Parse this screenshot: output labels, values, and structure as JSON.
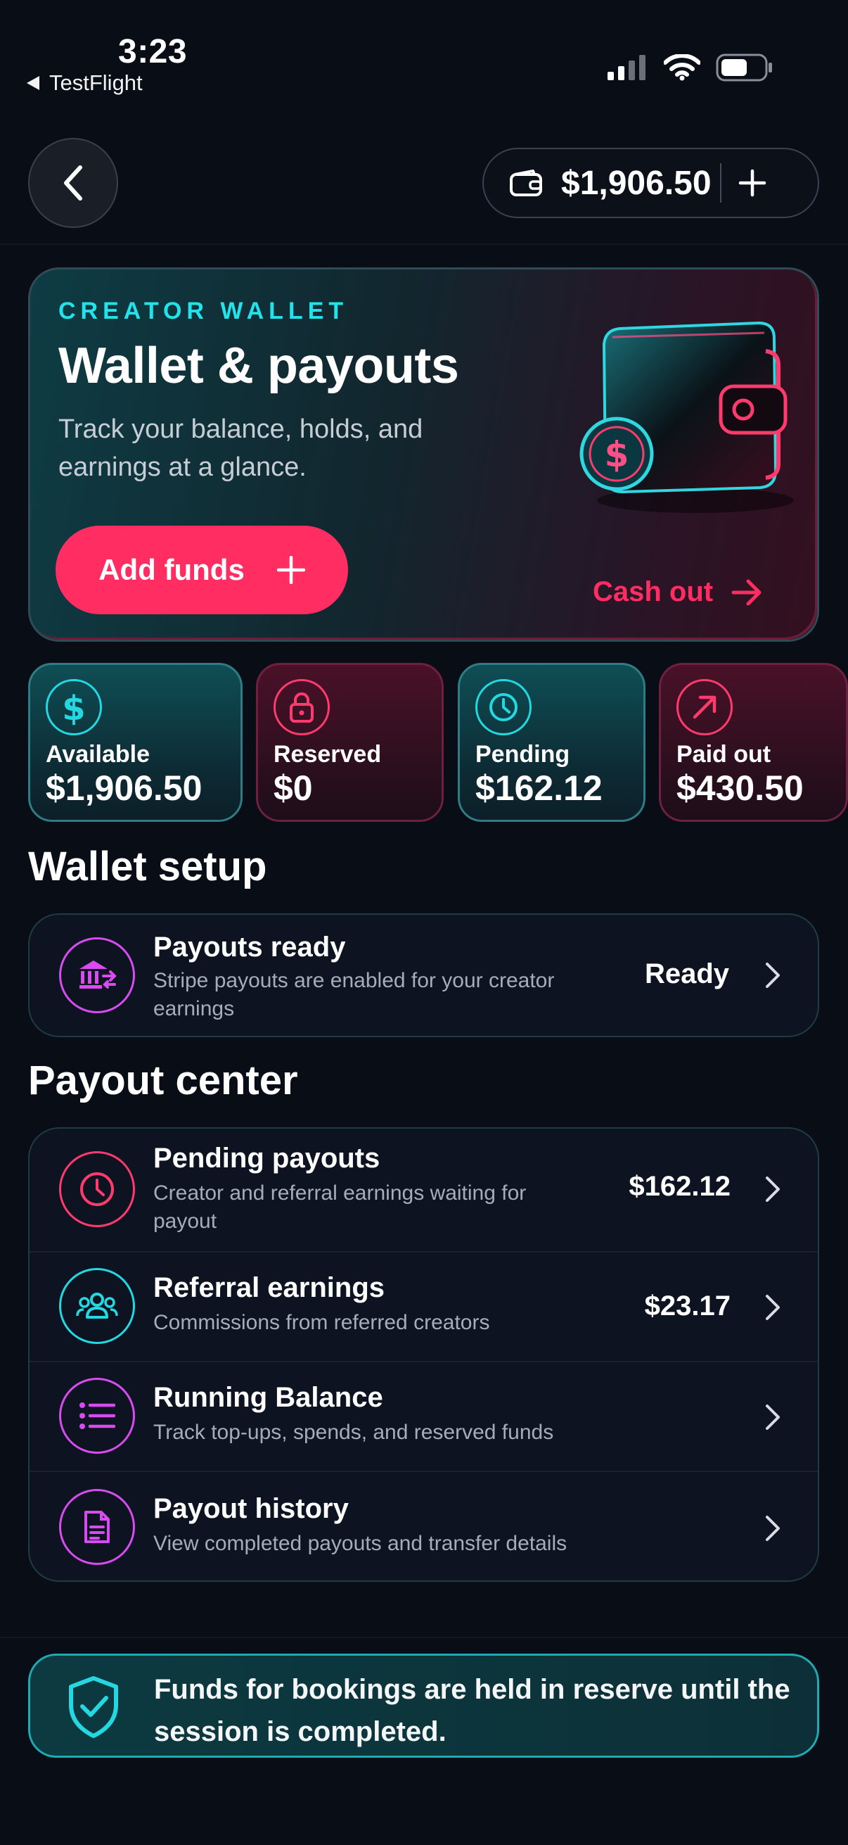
{
  "status_bar": {
    "time": "3:23",
    "back_app": "TestFlight"
  },
  "header": {
    "balance": "$1,906.50"
  },
  "hero": {
    "eyebrow": "CREATOR WALLET",
    "title": "Wallet & payouts",
    "subtitle": "Track your balance, holds, and earnings at a glance.",
    "add_funds_label": "Add funds",
    "cash_out_label": "Cash out"
  },
  "stats": [
    {
      "label": "Available",
      "value": "$1,906.50",
      "icon": "dollar-icon",
      "accent": "#23d8e0"
    },
    {
      "label": "Reserved",
      "value": "$0",
      "icon": "lock-icon",
      "accent": "#ff3b6e"
    },
    {
      "label": "Pending",
      "value": "$162.12",
      "icon": "clock-icon",
      "accent": "#23d8e0"
    },
    {
      "label": "Paid out",
      "value": "$430.50",
      "icon": "arrow-up-right-icon",
      "accent": "#ff3b6e"
    }
  ],
  "wallet_setup": {
    "title": "Wallet setup",
    "item": {
      "title": "Payouts ready",
      "subtitle": "Stripe payouts are enabled for your creator earnings",
      "status": "Ready",
      "icon": "bank-transfer-icon"
    }
  },
  "payout_center": {
    "title": "Payout center",
    "items": [
      {
        "title": "Pending payouts",
        "subtitle": "Creator and referral earnings waiting for payout",
        "value": "$162.12",
        "icon": "clock-icon"
      },
      {
        "title": "Referral earnings",
        "subtitle": "Commissions from referred creators",
        "value": "$23.17",
        "icon": "people-icon"
      },
      {
        "title": "Running Balance",
        "subtitle": "Track top-ups, spends, and reserved funds",
        "value": "",
        "icon": "list-icon"
      },
      {
        "title": "Payout history",
        "subtitle": "View completed payouts and transfer details",
        "value": "",
        "icon": "document-icon"
      }
    ]
  },
  "notice": {
    "text": "Funds for bookings are held in reserve until the session is completed.",
    "icon": "shield-check-icon"
  },
  "colors": {
    "background": "#080d16",
    "accent_pink": "#ff2d62",
    "accent_cyan": "#22e3ea",
    "accent_purple": "#d94bf0"
  }
}
